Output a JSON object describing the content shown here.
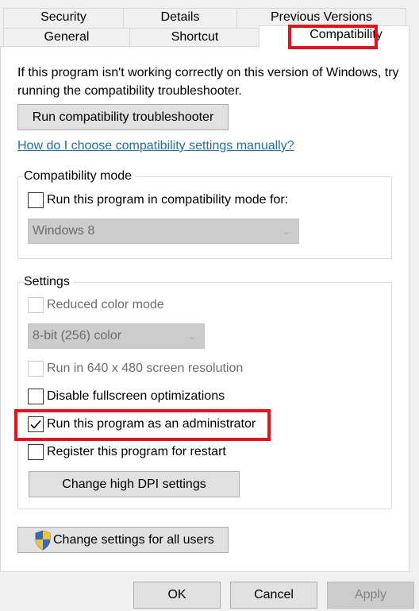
{
  "tabs": {
    "row1": [
      {
        "label": "Security"
      },
      {
        "label": "Details"
      },
      {
        "label": "Previous Versions"
      }
    ],
    "row2": [
      {
        "label": "General"
      },
      {
        "label": "Shortcut"
      },
      {
        "label": "Compatibility",
        "active": true
      }
    ]
  },
  "intro_text": "If this program isn't working correctly on this version of Windows, try running the compatibility troubleshooter.",
  "troubleshooter_button": "Run compatibility troubleshooter",
  "help_link": "How do I choose compatibility settings manually?",
  "compat_mode": {
    "label": "Compatibility mode",
    "checkbox": {
      "label": "Run this program in compatibility mode for:",
      "checked": false
    },
    "select": {
      "value": "Windows 8",
      "disabled": true
    }
  },
  "settings": {
    "label": "Settings",
    "reduced_color": {
      "label": "Reduced color mode",
      "checked": false,
      "disabled": true
    },
    "color_select": {
      "value": "8-bit (256) color",
      "disabled": true
    },
    "res_640": {
      "label": "Run in 640 x 480 screen resolution",
      "checked": false,
      "disabled": true
    },
    "disable_fullscreen": {
      "label": "Disable fullscreen optimizations",
      "checked": false
    },
    "run_as_admin": {
      "label": "Run this program as an administrator",
      "checked": true
    },
    "register_restart": {
      "label": "Register this program for restart",
      "checked": false
    },
    "dpi_button": "Change high DPI settings"
  },
  "all_users_button": "Change settings for all users",
  "footer": {
    "ok": "OK",
    "cancel": "Cancel",
    "apply": "Apply"
  },
  "colors": {
    "highlight": "#e2141b",
    "link": "#1f6ead"
  }
}
